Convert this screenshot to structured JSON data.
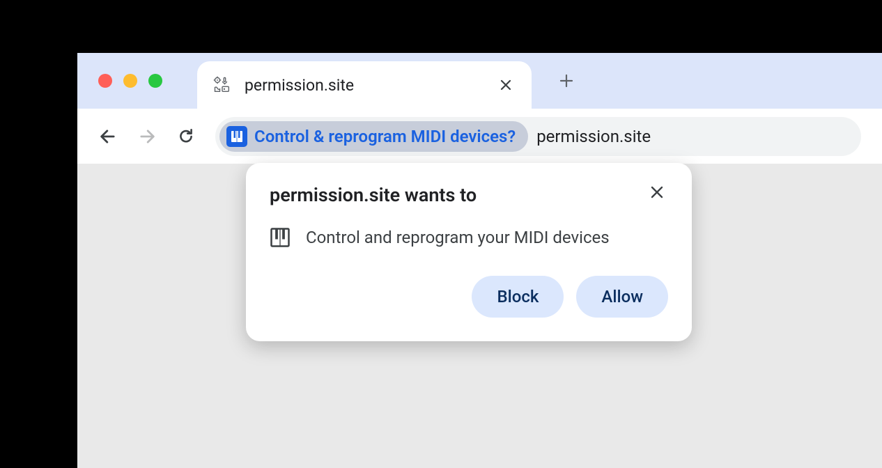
{
  "tabs": [
    {
      "title": "permission.site"
    }
  ],
  "omnibox": {
    "chip_label": "Control & reprogram MIDI devices?",
    "url": "permission.site"
  },
  "dialog": {
    "title": "permission.site wants to",
    "permission_text": "Control and reprogram your MIDI devices",
    "block_label": "Block",
    "allow_label": "Allow"
  }
}
